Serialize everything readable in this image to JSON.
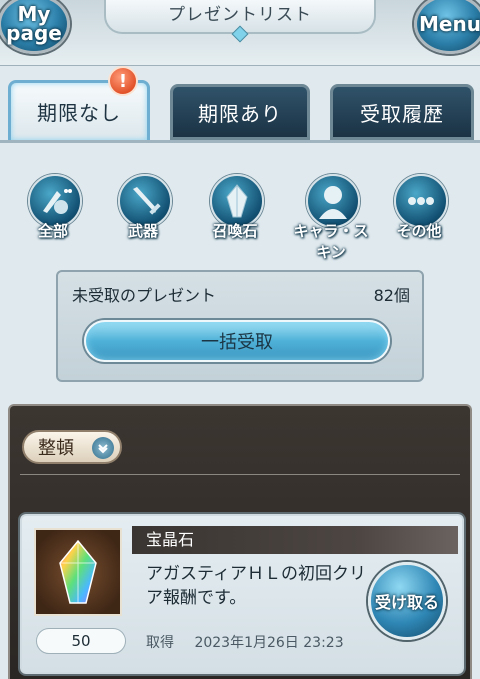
{
  "header": {
    "title": "プレゼントリスト",
    "mypage_label_line1": "My",
    "mypage_label_line2": "page",
    "menu_label": "Menu"
  },
  "tabs": [
    {
      "label": "期限なし",
      "active": true,
      "badge": "!"
    },
    {
      "label": "期限あり",
      "active": false
    },
    {
      "label": "受取履歴",
      "active": false
    }
  ],
  "filters": [
    {
      "label": "全部",
      "icon": "all-items-icon"
    },
    {
      "label": "武器",
      "icon": "weapon-icon"
    },
    {
      "label": "召喚石",
      "icon": "summon-stone-icon"
    },
    {
      "label": "キャラ・スキン",
      "icon": "character-skin-icon"
    },
    {
      "label": "その他",
      "icon": "other-icon"
    }
  ],
  "claim_panel": {
    "label": "未受取のプレゼント",
    "count": "82個",
    "claim_all_label": "一括受取"
  },
  "list": {
    "sort_label": "整頓",
    "items": [
      {
        "name": "宝晶石",
        "description": "アガスティアＨＬの初回クリア報酬です。",
        "quantity": "50",
        "acquired_label": "取得",
        "acquired_date": "2023年1月26日 23:23",
        "receive_label": "受け取る",
        "icon": "crystal-icon"
      }
    ]
  },
  "colors": {
    "accent": "#4fb1d8",
    "badge": "#e2532a",
    "dark_panel": "#2a2623"
  }
}
